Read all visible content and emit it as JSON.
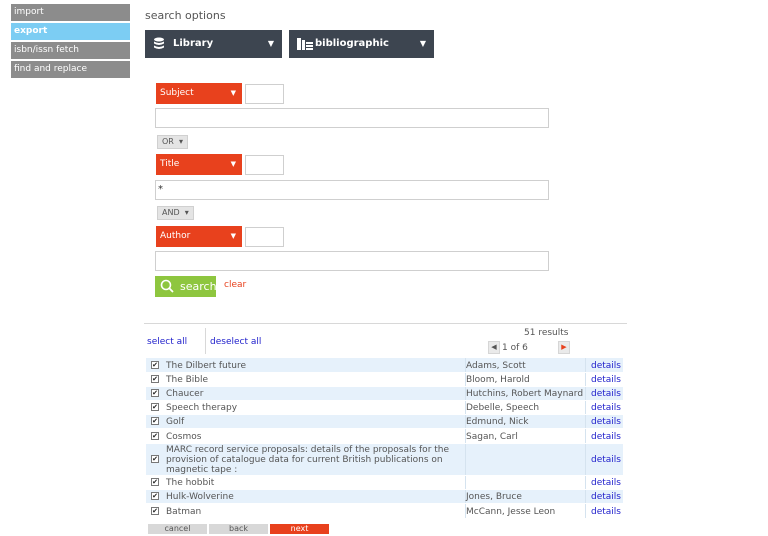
{
  "nav": {
    "items": [
      {
        "label": "import"
      },
      {
        "label": "export"
      },
      {
        "label": "isbn/issn fetch"
      },
      {
        "label": "find and replace"
      }
    ]
  },
  "search_options": {
    "heading": "search options",
    "library_label": "Library",
    "record_type_label": "bibliographic"
  },
  "criteria": {
    "field1": {
      "label": "Subject",
      "value": ""
    },
    "op1": "OR",
    "field2": {
      "label": "Title",
      "value": "*"
    },
    "op2": "AND",
    "field3": {
      "label": "Author",
      "value": ""
    },
    "search_label": "search",
    "clear_label": "clear"
  },
  "results": {
    "select_all": "select all",
    "deselect_all": "deselect all",
    "count": "51 results",
    "page": "1 of 6",
    "details_label": "details",
    "rows": [
      {
        "title": "The Dilbert future",
        "author": "Adams, Scott"
      },
      {
        "title": "The Bible",
        "author": "Bloom, Harold"
      },
      {
        "title": "Chaucer",
        "author": "Hutchins, Robert Maynard"
      },
      {
        "title": "Speech therapy",
        "author": "Debelle, Speech"
      },
      {
        "title": "Golf",
        "author": "Edmund, Nick"
      },
      {
        "title": "Cosmos",
        "author": "Sagan, Carl"
      },
      {
        "title": "MARC record service proposals: details of the proposals for the provision of catalogue data for current British publications on magnetic tape :",
        "author": ""
      },
      {
        "title": "The hobbit",
        "author": ""
      },
      {
        "title": "Hulk-Wolverine",
        "author": "Jones, Bruce"
      },
      {
        "title": "Batman",
        "author": "McCann, Jesse Leon"
      }
    ]
  },
  "footer": {
    "cancel": "cancel",
    "back": "back",
    "next": "next"
  },
  "icons": {
    "library": "database-icon",
    "bibliographic": "books-icon",
    "search": "magnifier-icon",
    "prev": "chevron-left-icon",
    "next": "chevron-right-icon"
  },
  "colors": {
    "accent": "#e8411d",
    "nav_active": "#7ccdf3",
    "nav": "#8c8c8c",
    "search": "#8ec63f",
    "dropdown": "#3d4550",
    "row_alt": "#e6f1fb",
    "link": "#2222cc"
  }
}
